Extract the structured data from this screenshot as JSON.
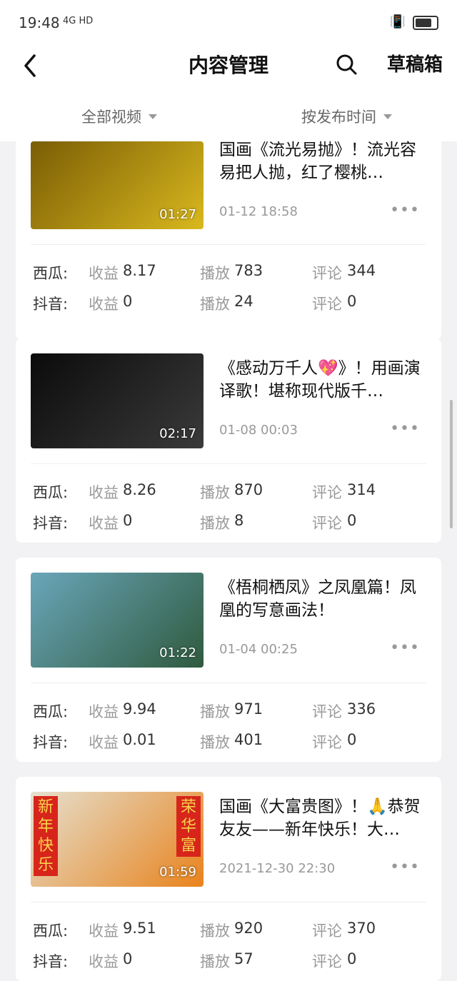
{
  "status": {
    "time": "19:48",
    "signal": "4G HD"
  },
  "header": {
    "title": "内容管理",
    "drafts": "草稿箱"
  },
  "filters": [
    {
      "label": "全部视频"
    },
    {
      "label": "按发布时间"
    }
  ],
  "labels": {
    "revenue": "收益",
    "plays": "播放",
    "comments": "评论"
  },
  "videos": [
    {
      "title": "国画《流光易抛》！流光容易把人抛，红了樱桃…",
      "date": "01-12 18:58",
      "duration": "01:27",
      "thumb_colors": [
        "#7a5d05",
        "#d9b81e"
      ],
      "stats": [
        {
          "platform": "西瓜:",
          "revenue": "8.17",
          "plays": "783",
          "comments": "344"
        },
        {
          "platform": "抖音:",
          "revenue": "0",
          "plays": "24",
          "comments": "0"
        }
      ]
    },
    {
      "title": "《感动万千人💖》！用画演译歌！堪称现代版千…",
      "date": "01-08 00:03",
      "duration": "02:17",
      "thumb_colors": [
        "#0b0b0b",
        "#3a3a3a"
      ],
      "stats": [
        {
          "platform": "西瓜:",
          "revenue": "8.26",
          "plays": "870",
          "comments": "314"
        },
        {
          "platform": "抖音:",
          "revenue": "0",
          "plays": "8",
          "comments": "0"
        }
      ]
    },
    {
      "title": "《梧桐栖凤》之凤凰篇！凤凰的写意画法！",
      "date": "01-04 00:25",
      "duration": "01:22",
      "thumb_colors": [
        "#6aa6ba",
        "#2f5a3e"
      ],
      "stats": [
        {
          "platform": "西瓜:",
          "revenue": "9.94",
          "plays": "971",
          "comments": "336"
        },
        {
          "platform": "抖音:",
          "revenue": "0.01",
          "plays": "401",
          "comments": "0"
        }
      ]
    },
    {
      "title": "国画《大富贵图》！🙏恭贺友友——新年快乐！大…",
      "date": "2021-12-30 22:30",
      "duration": "01:59",
      "thumb_colors": [
        "#e5e0d0",
        "#e8831c"
      ],
      "banner_left": "新年快乐",
      "banner_right": "荣华富",
      "stats": [
        {
          "platform": "西瓜:",
          "revenue": "9.51",
          "plays": "920",
          "comments": "370"
        },
        {
          "platform": "抖音:",
          "revenue": "0",
          "plays": "57",
          "comments": "0"
        }
      ]
    }
  ]
}
